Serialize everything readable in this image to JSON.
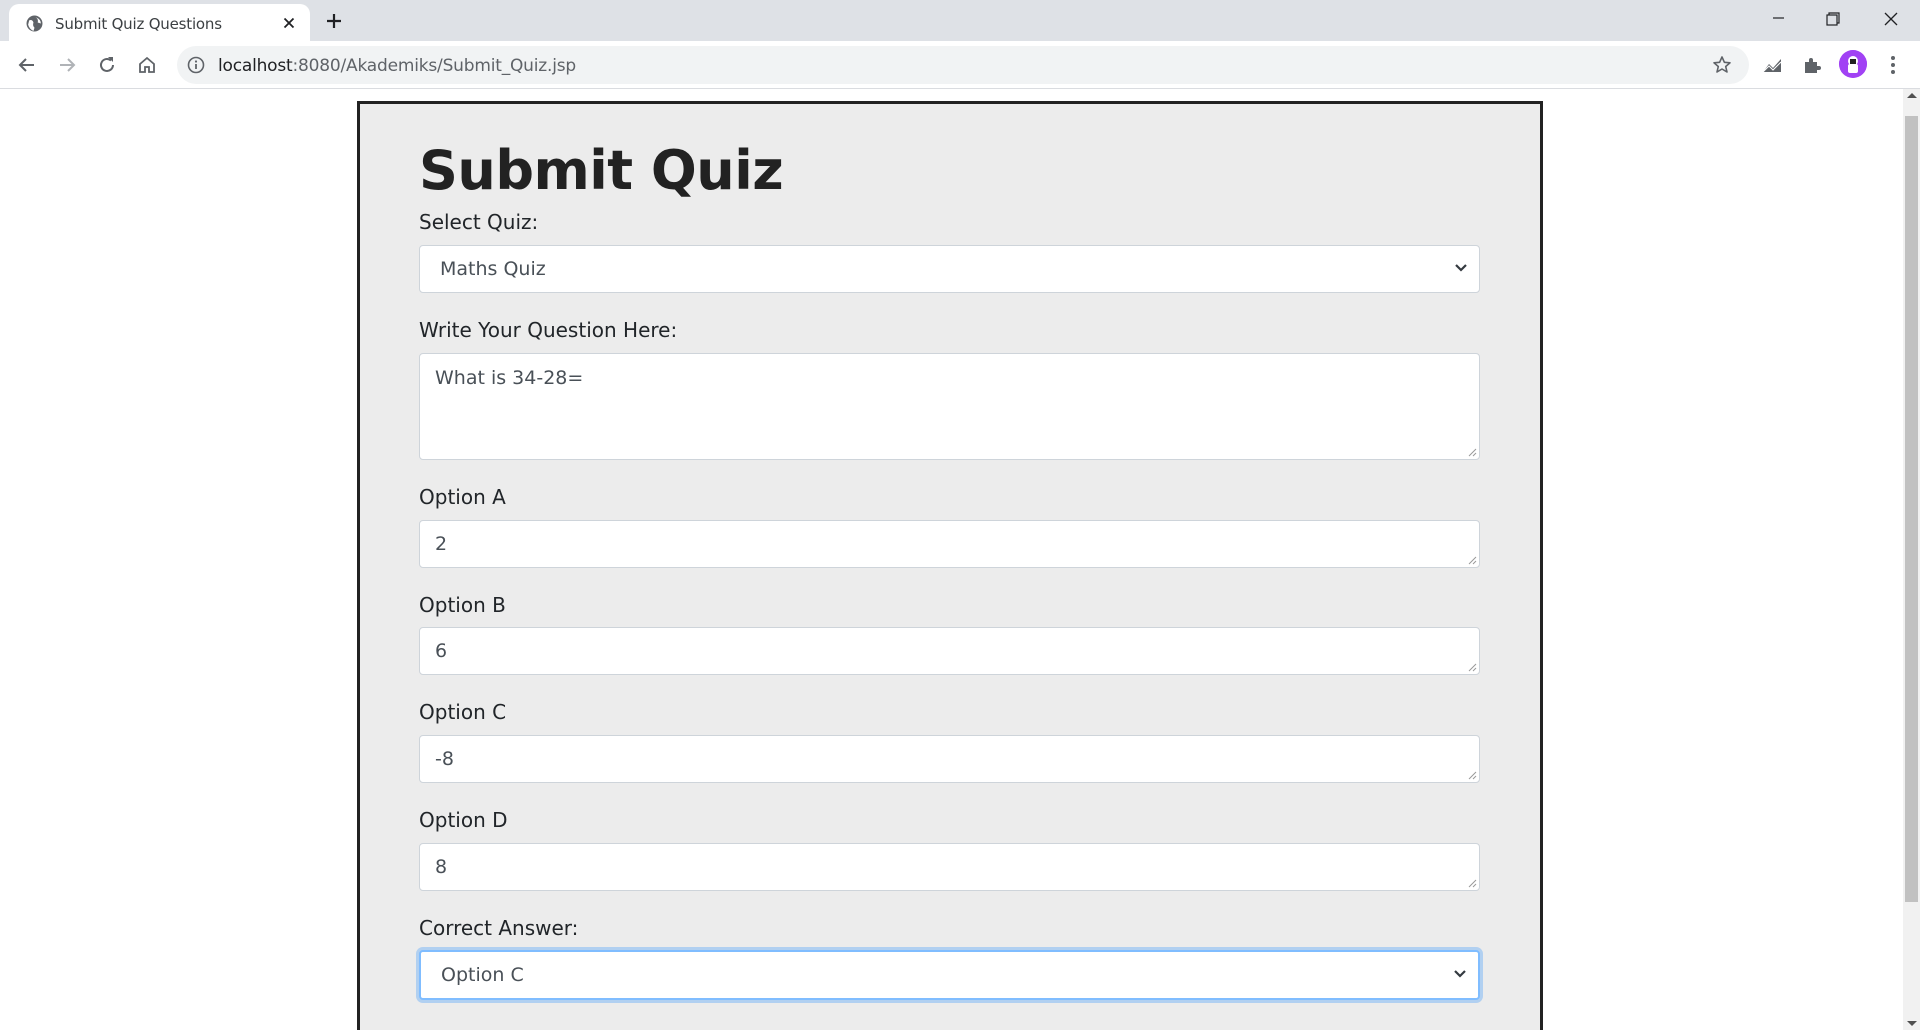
{
  "browser": {
    "tab_title": "Submit Quiz Questions",
    "url_host": "localhost",
    "url_rest": ":8080/Akademiks/Submit_Quiz.jsp"
  },
  "page": {
    "title": "Submit Quiz",
    "select_quiz_label": "Select Quiz:",
    "select_quiz_value": "Maths Quiz",
    "question_label": "Write Your Question Here:",
    "question_value": "What is 34-28=",
    "option_a_label": "Option A",
    "option_a_value": "2",
    "option_b_label": "Option B",
    "option_b_value": "6",
    "option_c_label": "Option C",
    "option_c_value": "-8",
    "option_d_label": "Option D",
    "option_d_value": "8",
    "correct_answer_label": "Correct Answer:",
    "correct_answer_value": "Option C"
  },
  "colors": {
    "tabstrip": "#dee1e6",
    "card_bg": "#ececec",
    "focus_ring": "#80bdff",
    "avatar": "#a142f4"
  }
}
